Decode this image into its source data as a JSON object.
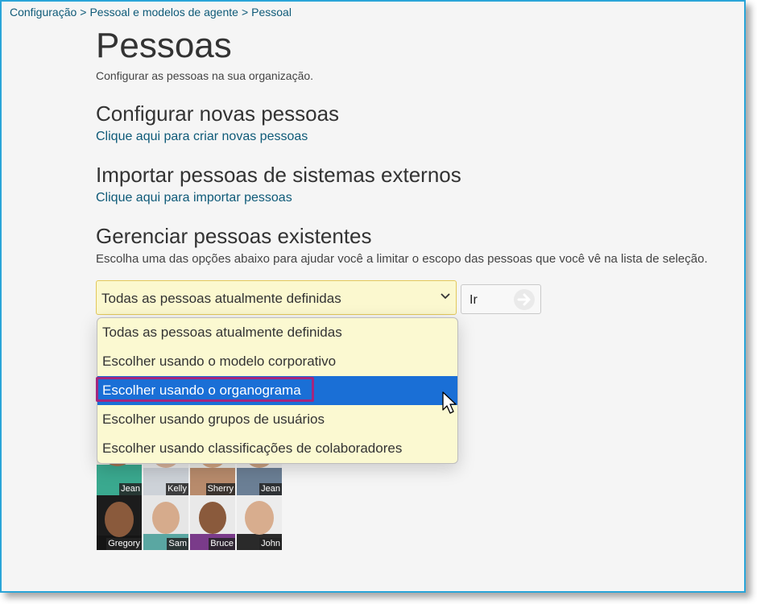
{
  "breadcrumb": [
    "Configuração",
    "Pessoal e modelos de agente",
    "Pessoal"
  ],
  "page": {
    "title": "Pessoas",
    "description": "Configurar as pessoas na sua organização."
  },
  "sections": {
    "new": {
      "title": "Configurar novas pessoas",
      "link": "Clique aqui para criar novas pessoas"
    },
    "import": {
      "title": "Importar pessoas de sistemas externos",
      "link": "Clique aqui para importar pessoas"
    },
    "manage": {
      "title": "Gerenciar pessoas existentes",
      "description": "Escolha uma das opções abaixo para ajudar você a limitar o escopo das pessoas que você vê na lista de seleção."
    }
  },
  "filter": {
    "selected": "Todas as pessoas atualmente definidas",
    "go_label": "Ir",
    "options": [
      "Todas as pessoas atualmente definidas",
      "Escolher usando o modelo corporativo",
      "Escolher usando o organograma",
      "Escolher usando grupos de usuários",
      "Escolher usando classificações de colaboradores"
    ],
    "highlighted_index": 2
  },
  "people": [
    {
      "name": "Jean",
      "icon": "person-photo"
    },
    {
      "name": "Kelly",
      "icon": "person-photo"
    },
    {
      "name": "Sherry",
      "icon": "person-photo"
    },
    {
      "name": "Jean",
      "icon": "person-photo"
    },
    {
      "name": "Gregory",
      "icon": "person-photo"
    },
    {
      "name": "Sam",
      "icon": "person-photo"
    },
    {
      "name": "Bruce",
      "icon": "person-photo"
    },
    {
      "name": "John",
      "icon": "person-photo"
    }
  ],
  "colors": {
    "link": "#0e5a78",
    "select_bg": "#fbf8cf",
    "active_option": "#1a6fd6",
    "highlight_border": "#a3267e",
    "frame_border": "#2aa5d8"
  }
}
